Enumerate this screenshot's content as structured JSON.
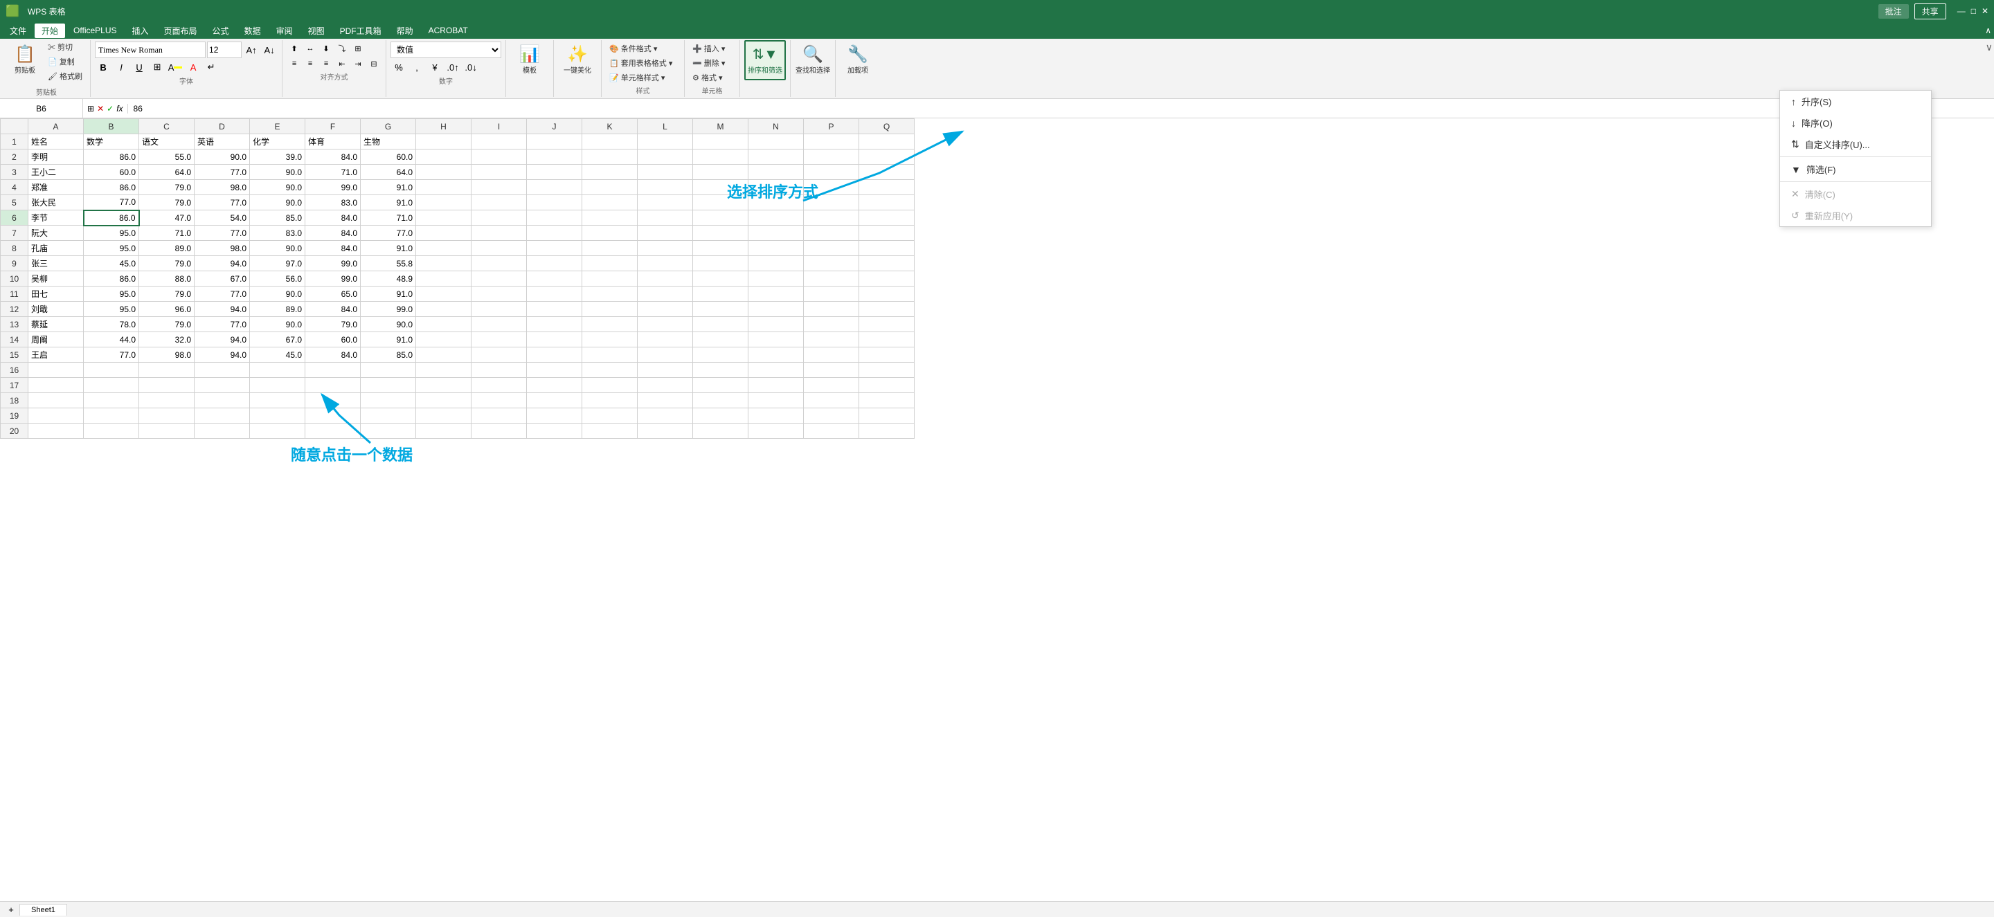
{
  "titleBar": {
    "appName": "WPS 表格",
    "rightBtns": [
      "批注",
      "共享"
    ]
  },
  "menuBar": {
    "items": [
      "文件",
      "开始",
      "OfficePLUS",
      "插入",
      "页面布局",
      "公式",
      "数据",
      "审阅",
      "视图",
      "PDF工具箱",
      "帮助",
      "ACROBAT"
    ]
  },
  "ribbon": {
    "fontName": "Times New Roman",
    "fontSize": "12",
    "formatType": "数值",
    "groups": [
      "剪贴板",
      "字体",
      "对齐方式",
      "数字",
      "模板",
      "一键美化",
      "样式",
      "单元格",
      "排序和筛选",
      "查找和选择",
      "加载项"
    ]
  },
  "formulaBar": {
    "cellRef": "B6",
    "formula": "86"
  },
  "headers": [
    "姓名",
    "数学",
    "语文",
    "英语",
    "化学",
    "体育",
    "生物"
  ],
  "rows": [
    {
      "name": "李明",
      "math": "86.0",
      "chinese": "55.0",
      "english": "90.0",
      "chemistry": "39.0",
      "pe": "84.0",
      "bio": "60.0"
    },
    {
      "name": "王小二",
      "math": "60.0",
      "chinese": "64.0",
      "english": "77.0",
      "chemistry": "90.0",
      "pe": "71.0",
      "bio": "64.0"
    },
    {
      "name": "郑准",
      "math": "86.0",
      "chinese": "79.0",
      "english": "98.0",
      "chemistry": "90.0",
      "pe": "99.0",
      "bio": "91.0"
    },
    {
      "name": "张大民",
      "math": "77.0",
      "chinese": "79.0",
      "english": "77.0",
      "chemistry": "90.0",
      "pe": "83.0",
      "bio": "91.0"
    },
    {
      "name": "李节",
      "math": "86.0",
      "chinese": "47.0",
      "english": "54.0",
      "chemistry": "85.0",
      "pe": "84.0",
      "bio": "71.0"
    },
    {
      "name": "阮大",
      "math": "95.0",
      "chinese": "71.0",
      "english": "77.0",
      "chemistry": "83.0",
      "pe": "84.0",
      "bio": "77.0"
    },
    {
      "name": "孔庙",
      "math": "95.0",
      "chinese": "89.0",
      "english": "98.0",
      "chemistry": "90.0",
      "pe": "84.0",
      "bio": "91.0"
    },
    {
      "name": "张三",
      "math": "45.0",
      "chinese": "79.0",
      "english": "94.0",
      "chemistry": "97.0",
      "pe": "99.0",
      "bio": "55.8"
    },
    {
      "name": "吴柳",
      "math": "86.0",
      "chinese": "88.0",
      "english": "67.0",
      "chemistry": "56.0",
      "pe": "99.0",
      "bio": "48.9"
    },
    {
      "name": "田七",
      "math": "95.0",
      "chinese": "79.0",
      "english": "77.0",
      "chemistry": "90.0",
      "pe": "65.0",
      "bio": "91.0"
    },
    {
      "name": "刘戢",
      "math": "95.0",
      "chinese": "96.0",
      "english": "94.0",
      "chemistry": "89.0",
      "pe": "84.0",
      "bio": "99.0"
    },
    {
      "name": "蔡延",
      "math": "78.0",
      "chinese": "79.0",
      "english": "77.0",
      "chemistry": "90.0",
      "pe": "79.0",
      "bio": "90.0"
    },
    {
      "name": "周阚",
      "math": "44.0",
      "chinese": "32.0",
      "english": "94.0",
      "chemistry": "67.0",
      "pe": "60.0",
      "bio": "91.0"
    },
    {
      "name": "王启",
      "math": "77.0",
      "chinese": "98.0",
      "english": "94.0",
      "chemistry": "45.0",
      "pe": "84.0",
      "bio": "85.0"
    }
  ],
  "sortDropdown": {
    "items": [
      {
        "label": "升序(S)",
        "icon": "↑",
        "enabled": true
      },
      {
        "label": "降序(O)",
        "icon": "↓",
        "enabled": true
      },
      {
        "label": "自定义排序(U)...",
        "icon": "⇅",
        "enabled": true
      },
      {
        "label": "筛选(F)",
        "icon": "▼",
        "enabled": true
      },
      {
        "label": "清除(C)",
        "icon": "✕",
        "enabled": false
      },
      {
        "label": "重新应用(Y)",
        "icon": "↺",
        "enabled": false
      }
    ]
  },
  "annotations": {
    "selectSortText": "选择排序方式",
    "clickDataText": "随意点击一个数据"
  },
  "colHeaders": [
    "A",
    "B",
    "C",
    "D",
    "E",
    "F",
    "G",
    "H",
    "I",
    "J",
    "K",
    "L",
    "M",
    "N",
    "P",
    "Q"
  ],
  "rowNumbers": [
    1,
    2,
    3,
    4,
    5,
    6,
    7,
    8,
    9,
    10,
    11,
    12,
    13,
    14,
    15,
    16,
    17,
    18,
    19,
    20
  ]
}
